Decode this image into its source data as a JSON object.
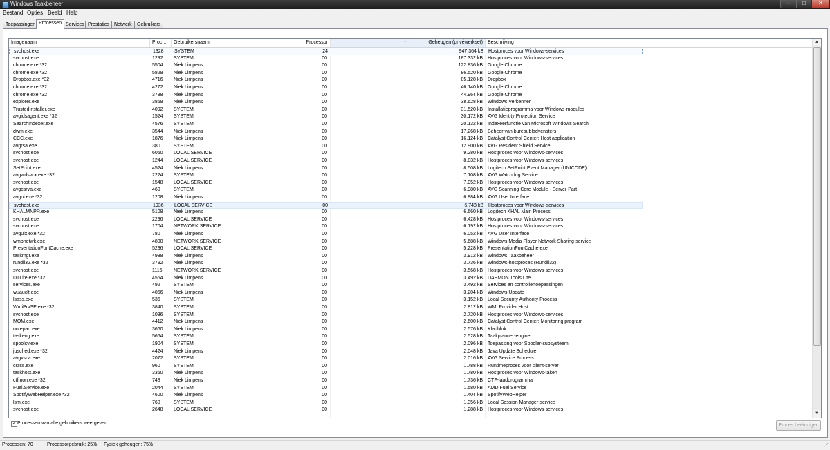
{
  "window": {
    "title": "Windows Taakbeheer",
    "min": "–",
    "max": "□",
    "close": "✕"
  },
  "menu": [
    "Bestand",
    "Opties",
    "Beeld",
    "Help"
  ],
  "tabs": [
    {
      "label": "Toepassingen"
    },
    {
      "label": "Processen",
      "active": true
    },
    {
      "label": "Services"
    },
    {
      "label": "Prestaties"
    },
    {
      "label": "Netwerk"
    },
    {
      "label": "Gebruikers"
    }
  ],
  "columns": {
    "image": "Imagenaam",
    "pid": "Proc...",
    "user": "Gebruikersnaam",
    "cpu": "Processor",
    "mem": "Geheugen (privéwerkset)",
    "desc": "Beschrijving"
  },
  "rows": [
    [
      "svchost.exe",
      "1328",
      "SYSTEM",
      "24",
      "947.364 kB",
      "Hostproces voor Windows-services"
    ],
    [
      "svchost.exe",
      "1292",
      "SYSTEM",
      "00",
      "187.332 kB",
      "Hostproces voor Windows-services"
    ],
    [
      "chrome.exe *32",
      "5504",
      "Niek Limpens",
      "00",
      "122.836 kB",
      "Google Chrome"
    ],
    [
      "chrome.exe *32",
      "5828",
      "Niek Limpens",
      "00",
      "86.520 kB",
      "Google Chrome"
    ],
    [
      "Dropbox.exe *32",
      "4716",
      "Niek Limpens",
      "00",
      "85.128 kB",
      "Dropbox"
    ],
    [
      "chrome.exe *32",
      "4272",
      "Niek Limpens",
      "00",
      "46.140 kB",
      "Google Chrome"
    ],
    [
      "chrome.exe *32",
      "3788",
      "Niek Limpens",
      "00",
      "44.964 kB",
      "Google Chrome"
    ],
    [
      "explorer.exe",
      "3868",
      "Niek Limpens",
      "00",
      "38.628 kB",
      "Windows Verkenner"
    ],
    [
      "TrustedInstaller.exe",
      "4092",
      "SYSTEM",
      "00",
      "31.520 kB",
      "Installatieprogramma voor Windows-modules"
    ],
    [
      "avgidsagent.exe *32",
      "1524",
      "SYSTEM",
      "00",
      "30.172 kB",
      "AVG Identity Protection Service"
    ],
    [
      "SearchIndexer.exe",
      "4576",
      "SYSTEM",
      "00",
      "20.132 kB",
      "Indexeerfunctie van Microsoft Windows Search"
    ],
    [
      "dwm.exe",
      "3544",
      "Niek Limpens",
      "00",
      "17.268 kB",
      "Beheer van bureaubladvensters"
    ],
    [
      "CCC.exe",
      "1876",
      "Niek Limpens",
      "00",
      "16.124 kB",
      "Catalyst Control Center: Host application"
    ],
    [
      "avgrsa.exe",
      "380",
      "SYSTEM",
      "00",
      "12.900 kB",
      "AVG Resident Shield Service"
    ],
    [
      "svchost.exe",
      "6060",
      "LOCAL SERVICE",
      "00",
      "9.280 kB",
      "Hostproces voor Windows-services"
    ],
    [
      "svchost.exe",
      "1244",
      "LOCAL SERVICE",
      "00",
      "8.832 kB",
      "Hostproces voor Windows-services"
    ],
    [
      "SetPoint.exe",
      "4524",
      "Niek Limpens",
      "00",
      "8.508 kB",
      "Logitech SetPoint Event Manager (UNICODE)"
    ],
    [
      "avgwdsvcx.exe *32",
      "2224",
      "SYSTEM",
      "00",
      "7.108 kB",
      "AVG Watchdog Service"
    ],
    [
      "svchost.exe",
      "1548",
      "LOCAL SERVICE",
      "00",
      "7.052 kB",
      "Hostproces voor Windows-services"
    ],
    [
      "avgcsrva.exe",
      "460",
      "SYSTEM",
      "00",
      "6.980 kB",
      "AVG Scanning Core Module - Server Part"
    ],
    [
      "avgui.exe *32",
      "1208",
      "Niek Limpens",
      "00",
      "6.884 kB",
      "AVG User Interface"
    ],
    [
      "svchost.exe",
      "1936",
      "LOCAL SERVICE",
      "00",
      "6.748 kB",
      "Hostproces voor Windows-services"
    ],
    [
      "KHALMNPR.exe",
      "5108",
      "Niek Limpens",
      "00",
      "6.660 kB",
      "Logitech KHAL Main Process"
    ],
    [
      "svchost.exe",
      "2296",
      "LOCAL SERVICE",
      "00",
      "6.428 kB",
      "Hostproces voor Windows-services"
    ],
    [
      "svchost.exe",
      "1704",
      "NETWORK SERVICE",
      "00",
      "6.192 kB",
      "Hostproces voor Windows-services"
    ],
    [
      "avguix.exe *32",
      "780",
      "Niek Limpens",
      "00",
      "6.052 kB",
      "AVG User Interface"
    ],
    [
      "wmpnetwk.exe",
      "4800",
      "NETWORK SERVICE",
      "00",
      "5.688 kB",
      "Windows Media Player Network Sharing-service"
    ],
    [
      "PresentationFontCache.exe",
      "5236",
      "LOCAL SERVICE",
      "00",
      "5.228 kB",
      "PresentationFontCache.exe"
    ],
    [
      "taskmgr.exe",
      "4988",
      "Niek Limpens",
      "00",
      "3.912 kB",
      "Windows Taakbeheer"
    ],
    [
      "rundll32.exe *32",
      "3792",
      "Niek Limpens",
      "00",
      "3.736 kB",
      "Windows-hostproces (Rundll32)"
    ],
    [
      "svchost.exe",
      "1116",
      "NETWORK SERVICE",
      "00",
      "3.568 kB",
      "Hostproces voor Windows-services"
    ],
    [
      "DTLite.exe *32",
      "4564",
      "Niek Limpens",
      "00",
      "3.492 kB",
      "DAEMON Tools Lite"
    ],
    [
      "services.exe",
      "492",
      "SYSTEM",
      "00",
      "3.492 kB",
      "Services en controllertoepassingen"
    ],
    [
      "wuauclt.exe",
      "4056",
      "Niek Limpens",
      "00",
      "3.204 kB",
      "Windows Update"
    ],
    [
      "lsass.exe",
      "536",
      "SYSTEM",
      "00",
      "3.152 kB",
      "Local Security Authority Process"
    ],
    [
      "WmiPrvSE.exe *32",
      "3840",
      "SYSTEM",
      "00",
      "2.812 kB",
      "WMI Provider Host"
    ],
    [
      "svchost.exe",
      "1036",
      "SYSTEM",
      "00",
      "2.720 kB",
      "Hostproces voor Windows-services"
    ],
    [
      "MOM.exe",
      "4412",
      "Niek Limpens",
      "00",
      "2.600 kB",
      "Catalyst Control Center: Monitoring program"
    ],
    [
      "notepad.exe",
      "3660",
      "Niek Limpens",
      "00",
      "2.576 kB",
      "Kladblok"
    ],
    [
      "taskeng.exe",
      "5664",
      "SYSTEM",
      "00",
      "2.528 kB",
      "Taakplanner-engine"
    ],
    [
      "spoolsv.exe",
      "1904",
      "SYSTEM",
      "00",
      "2.096 kB",
      "Toepassing voor Spooler-subsysteem"
    ],
    [
      "jusched.exe *32",
      "4424",
      "Niek Limpens",
      "00",
      "2.048 kB",
      "Java Update Scheduler"
    ],
    [
      "avgvsca.exe",
      "2072",
      "SYSTEM",
      "00",
      "2.016 kB",
      "AVG Service Process"
    ],
    [
      "csrss.exe",
      "960",
      "SYSTEM",
      "00",
      "1.788 kB",
      "Runtimeproces voor client-server"
    ],
    [
      "taskhost.exe",
      "3360",
      "Niek Limpens",
      "00",
      "1.780 kB",
      "Hostproces voor Windows-taken"
    ],
    [
      "ctfmon.exe *32",
      "748",
      "Niek Limpens",
      "00",
      "1.736 kB",
      "CTF-laadprogramma"
    ],
    [
      "Fuel.Service.exe",
      "2044",
      "SYSTEM",
      "00",
      "1.580 kB",
      "AMD Fuel Service"
    ],
    [
      "SpotifyWebHelper.exe *32",
      "4600",
      "Niek Limpens",
      "00",
      "1.404 kB",
      "SpotifyWebHelper"
    ],
    [
      "lsm.exe",
      "760",
      "SYSTEM",
      "00",
      "1.356 kB",
      "Local Session Manager-service"
    ],
    [
      "svchost.exe",
      "2648",
      "LOCAL SERVICE",
      "00",
      "1.288 kB",
      "Hostproces voor Windows-services"
    ]
  ],
  "show_all_users": {
    "label": "Processen van alle gebruikers weergeven",
    "checked": true,
    "mark": "✓"
  },
  "end_process_button": "Proces beëindigen",
  "status": {
    "processes": "Processen: 70",
    "cpu": "Processorgebruik: 25%",
    "memory": "Fysiek geheugen: 75%"
  },
  "icons": {
    "scroll_up": "▲",
    "scroll_down": "▼",
    "sort": "⌄",
    "grip": "⋰"
  }
}
